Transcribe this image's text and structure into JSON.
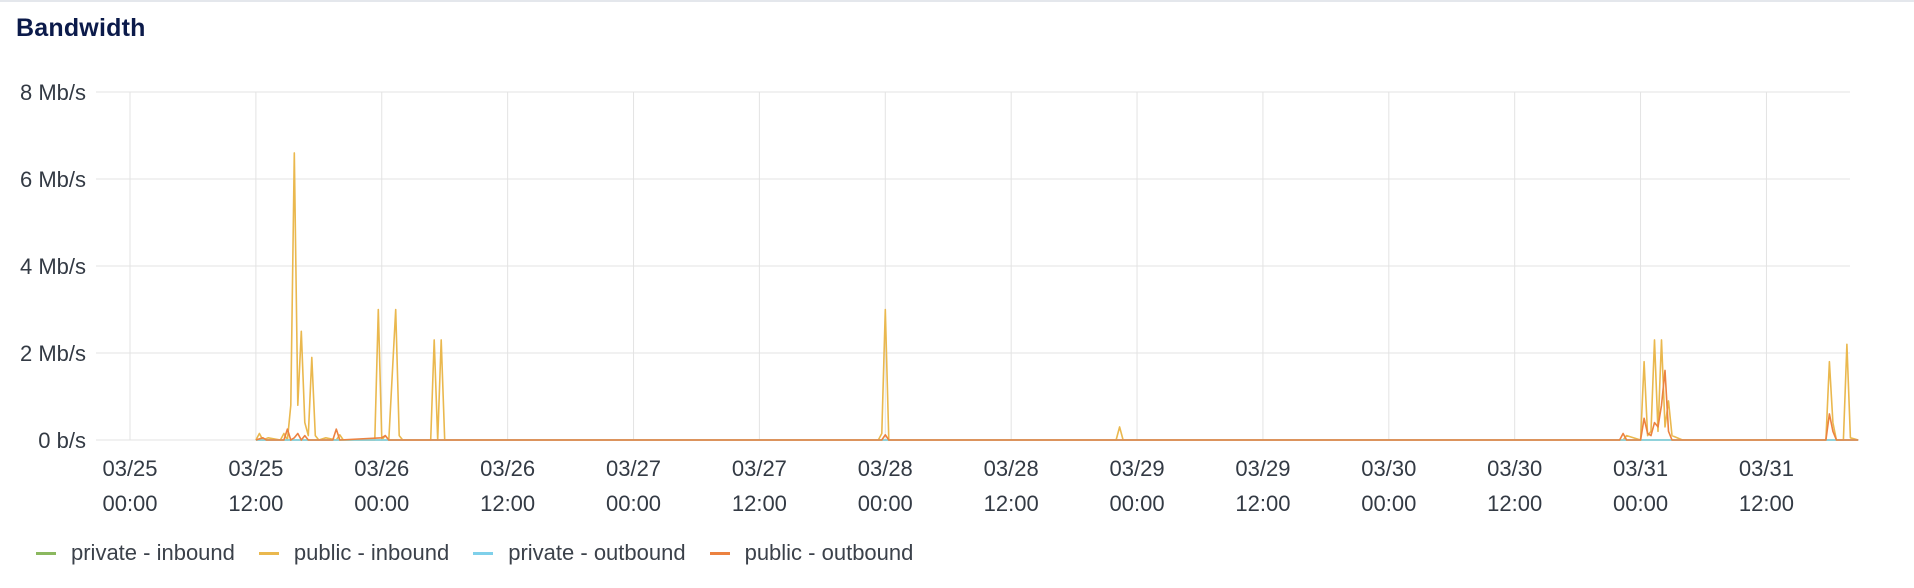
{
  "panel": {
    "title": "Bandwidth"
  },
  "colors": {
    "private_inbound": "#8bb85f",
    "public_inbound": "#eab84e",
    "private_outbound": "#7fd0ea",
    "public_outbound": "#ec8240",
    "grid": "#e3e3e3",
    "axis_text": "#333a44"
  },
  "chart_data": {
    "type": "line",
    "title": "Bandwidth",
    "xlabel": "",
    "ylabel": "",
    "ylim": [
      0,
      8
    ],
    "y_unit": "Mb/s",
    "y_ticks": [
      "0 b/s",
      "2 Mb/s",
      "4 Mb/s",
      "6 Mb/s",
      "8 Mb/s"
    ],
    "x_range": [
      "03/25 00:00",
      "03/31 21:00"
    ],
    "x_ticks": [
      {
        "date": "03/25",
        "time": "00:00"
      },
      {
        "date": "03/25",
        "time": "12:00"
      },
      {
        "date": "03/26",
        "time": "00:00"
      },
      {
        "date": "03/26",
        "time": "12:00"
      },
      {
        "date": "03/27",
        "time": "00:00"
      },
      {
        "date": "03/27",
        "time": "12:00"
      },
      {
        "date": "03/28",
        "time": "00:00"
      },
      {
        "date": "03/28",
        "time": "12:00"
      },
      {
        "date": "03/29",
        "time": "00:00"
      },
      {
        "date": "03/29",
        "time": "12:00"
      },
      {
        "date": "03/30",
        "time": "00:00"
      },
      {
        "date": "03/30",
        "time": "12:00"
      },
      {
        "date": "03/31",
        "time": "00:00"
      },
      {
        "date": "03/31",
        "time": "12:00"
      }
    ],
    "grid": true,
    "legend_position": "bottom-left",
    "series": [
      {
        "name": "private - inbound",
        "color": "#8bb85f",
        "x": [
          "03/25 12:00",
          "03/31 20:45"
        ],
        "y": [
          0,
          0
        ]
      },
      {
        "name": "public - inbound",
        "color": "#eab84e",
        "x": [
          "03/25 12:00",
          "03/25 12:20",
          "03/25 12:40",
          "03/25 13:10",
          "03/25 14:20",
          "03/25 14:40",
          "03/25 15:00",
          "03/25 15:20",
          "03/25 15:40",
          "03/25 16:00",
          "03/25 16:20",
          "03/25 16:40",
          "03/25 17:00",
          "03/25 17:20",
          "03/25 17:40",
          "03/25 18:00",
          "03/25 18:40",
          "03/25 19:40",
          "03/25 20:00",
          "03/25 20:20",
          "03/25 23:20",
          "03/25 23:40",
          "03/26 00:00",
          "03/26 00:20",
          "03/26 00:40",
          "03/26 01:20",
          "03/26 01:40",
          "03/26 02:00",
          "03/26 03:40",
          "03/26 04:40",
          "03/26 05:00",
          "03/26 05:20",
          "03/26 05:40",
          "03/26 06:00",
          "03/26 06:20",
          "03/26 08:00",
          "03/27 23:20",
          "03/27 23:40",
          "03/28 00:00",
          "03/28 00:20",
          "03/28 22:00",
          "03/28 22:20",
          "03/28 22:40",
          "03/30 22:20",
          "03/30 22:40",
          "03/31 00:00",
          "03/31 00:20",
          "03/31 00:40",
          "03/31 01:00",
          "03/31 01:20",
          "03/31 01:40",
          "03/31 02:00",
          "03/31 02:20",
          "03/31 02:40",
          "03/31 03:00",
          "03/31 04:00",
          "03/31 17:40",
          "03/31 18:00",
          "03/31 18:20",
          "03/31 18:40",
          "03/31 19:20",
          "03/31 19:40",
          "03/31 20:00",
          "03/31 20:45"
        ],
        "y": [
          0,
          0.15,
          0,
          0.05,
          0,
          0.15,
          0,
          0.8,
          6.6,
          0.8,
          2.5,
          0.4,
          0.1,
          1.9,
          0.1,
          0,
          0.05,
          0,
          0.12,
          0,
          0,
          3.0,
          0,
          0.1,
          0,
          3.0,
          0.1,
          0,
          0,
          0,
          2.3,
          0,
          2.3,
          0,
          0,
          0,
          0,
          0.15,
          3.0,
          0,
          0,
          0.3,
          0,
          0,
          0.1,
          0,
          1.8,
          0.1,
          0.2,
          2.3,
          0.2,
          2.3,
          0.3,
          0.9,
          0.1,
          0,
          0,
          1.8,
          0.4,
          0,
          0,
          2.2,
          0.05,
          0
        ]
      },
      {
        "name": "private - outbound",
        "color": "#7fd0ea",
        "x": [
          "03/25 12:00",
          "03/31 20:45"
        ],
        "y": [
          0,
          0
        ]
      },
      {
        "name": "public - outbound",
        "color": "#ec8240",
        "x": [
          "03/25 12:00",
          "03/25 12:40",
          "03/25 13:00",
          "03/25 14:40",
          "03/25 15:00",
          "03/25 15:20",
          "03/25 15:40",
          "03/25 16:00",
          "03/25 16:20",
          "03/25 16:40",
          "03/25 17:00",
          "03/25 19:20",
          "03/25 19:40",
          "03/25 20:00",
          "03/26 00:00",
          "03/26 00:20",
          "03/26 00:40",
          "03/27 23:40",
          "03/28 00:00",
          "03/28 00:20",
          "03/30 22:00",
          "03/30 22:20",
          "03/30 22:40",
          "03/30 23:00",
          "03/31 00:00",
          "03/31 00:20",
          "03/31 00:40",
          "03/31 01:00",
          "03/31 01:20",
          "03/31 01:40",
          "03/31 02:00",
          "03/31 02:20",
          "03/31 02:40",
          "03/31 03:00",
          "03/31 17:40",
          "03/31 18:00",
          "03/31 18:20",
          "03/31 18:40",
          "03/31 20:45"
        ],
        "y": [
          0,
          0.05,
          0,
          0,
          0.25,
          0,
          0.05,
          0.15,
          0,
          0.1,
          0,
          0,
          0.25,
          0,
          0.05,
          0.1,
          0,
          0,
          0.12,
          0,
          0,
          0.15,
          0,
          0,
          0,
          0.5,
          0.15,
          0.1,
          0.4,
          0.3,
          0.8,
          1.6,
          0.2,
          0,
          0,
          0.6,
          0.2,
          0,
          0
        ]
      }
    ]
  }
}
